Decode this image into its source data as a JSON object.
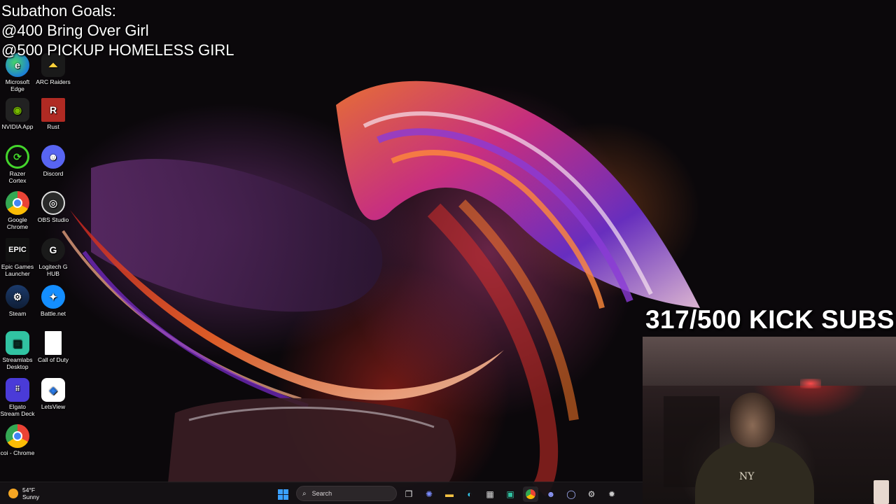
{
  "overlay": {
    "goals_title": "Subathon Goals:",
    "goal_1": "@400 Bring Over Girl",
    "goal_2": "@500 PICKUP HOMELESS GIRL",
    "kick_subs": "317/500 KICK SUBS"
  },
  "desktop": {
    "icons": [
      {
        "label": "Microsoft Edge",
        "icon": "edge-icon"
      },
      {
        "label": "ARC Raiders",
        "icon": "arc-raiders-icon"
      },
      {
        "label": "NVIDIA App",
        "icon": "nvidia-icon"
      },
      {
        "label": "Rust",
        "icon": "rust-icon"
      },
      {
        "label": "Razer Cortex",
        "icon": "razer-icon"
      },
      {
        "label": "Discord",
        "icon": "discord-icon"
      },
      {
        "label": "Google Chrome",
        "icon": "chrome-icon"
      },
      {
        "label": "OBS Studio",
        "icon": "obs-icon"
      },
      {
        "label": "Epic Games Launcher",
        "icon": "epic-games-icon"
      },
      {
        "label": "Logitech G HUB",
        "icon": "logitech-icon"
      },
      {
        "label": "Steam",
        "icon": "steam-icon"
      },
      {
        "label": "Battle.net",
        "icon": "battlenet-icon"
      },
      {
        "label": "Streamlabs Desktop",
        "icon": "streamlabs-icon"
      },
      {
        "label": "Call of Duty",
        "icon": "file-icon"
      },
      {
        "label": "Elgato Stream Deck",
        "icon": "stream-deck-icon"
      },
      {
        "label": "LetsView",
        "icon": "letsview-icon"
      },
      {
        "label": "coi - Chrome",
        "icon": "chrome-icon"
      }
    ]
  },
  "taskbar": {
    "weather_temp": "54°F",
    "weather_condition": "Sunny",
    "search_placeholder": "Search",
    "icons": [
      "windows-start-icon",
      "search-icon",
      "task-view-icon",
      "copilot-icon",
      "file-explorer-icon",
      "edge-icon",
      "store-icon",
      "streamlabs-icon",
      "chrome-icon",
      "discord-icon",
      "app-icon",
      "steam-icon",
      "settings-icon"
    ]
  },
  "colors": {
    "taskbar_bg": "#161216",
    "accent_sun": "#f5a623",
    "windows_blue": "#3aa0ff"
  }
}
